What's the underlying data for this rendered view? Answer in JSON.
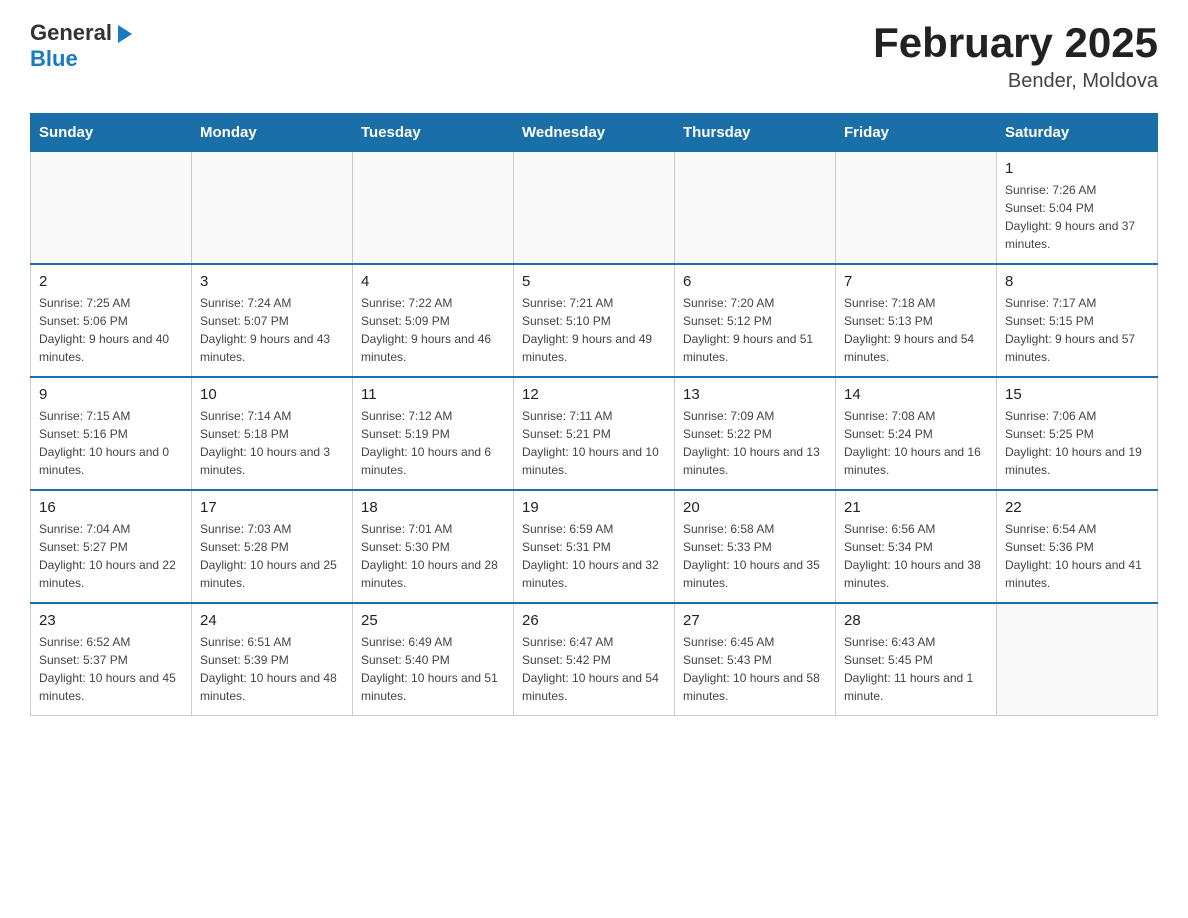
{
  "header": {
    "logo": {
      "general": "General",
      "arrow": "▶",
      "blue": "Blue"
    },
    "title": "February 2025",
    "subtitle": "Bender, Moldova"
  },
  "weekdays": [
    "Sunday",
    "Monday",
    "Tuesday",
    "Wednesday",
    "Thursday",
    "Friday",
    "Saturday"
  ],
  "weeks": [
    [
      {
        "day": "",
        "info": ""
      },
      {
        "day": "",
        "info": ""
      },
      {
        "day": "",
        "info": ""
      },
      {
        "day": "",
        "info": ""
      },
      {
        "day": "",
        "info": ""
      },
      {
        "day": "",
        "info": ""
      },
      {
        "day": "1",
        "info": "Sunrise: 7:26 AM\nSunset: 5:04 PM\nDaylight: 9 hours and 37 minutes."
      }
    ],
    [
      {
        "day": "2",
        "info": "Sunrise: 7:25 AM\nSunset: 5:06 PM\nDaylight: 9 hours and 40 minutes."
      },
      {
        "day": "3",
        "info": "Sunrise: 7:24 AM\nSunset: 5:07 PM\nDaylight: 9 hours and 43 minutes."
      },
      {
        "day": "4",
        "info": "Sunrise: 7:22 AM\nSunset: 5:09 PM\nDaylight: 9 hours and 46 minutes."
      },
      {
        "day": "5",
        "info": "Sunrise: 7:21 AM\nSunset: 5:10 PM\nDaylight: 9 hours and 49 minutes."
      },
      {
        "day": "6",
        "info": "Sunrise: 7:20 AM\nSunset: 5:12 PM\nDaylight: 9 hours and 51 minutes."
      },
      {
        "day": "7",
        "info": "Sunrise: 7:18 AM\nSunset: 5:13 PM\nDaylight: 9 hours and 54 minutes."
      },
      {
        "day": "8",
        "info": "Sunrise: 7:17 AM\nSunset: 5:15 PM\nDaylight: 9 hours and 57 minutes."
      }
    ],
    [
      {
        "day": "9",
        "info": "Sunrise: 7:15 AM\nSunset: 5:16 PM\nDaylight: 10 hours and 0 minutes."
      },
      {
        "day": "10",
        "info": "Sunrise: 7:14 AM\nSunset: 5:18 PM\nDaylight: 10 hours and 3 minutes."
      },
      {
        "day": "11",
        "info": "Sunrise: 7:12 AM\nSunset: 5:19 PM\nDaylight: 10 hours and 6 minutes."
      },
      {
        "day": "12",
        "info": "Sunrise: 7:11 AM\nSunset: 5:21 PM\nDaylight: 10 hours and 10 minutes."
      },
      {
        "day": "13",
        "info": "Sunrise: 7:09 AM\nSunset: 5:22 PM\nDaylight: 10 hours and 13 minutes."
      },
      {
        "day": "14",
        "info": "Sunrise: 7:08 AM\nSunset: 5:24 PM\nDaylight: 10 hours and 16 minutes."
      },
      {
        "day": "15",
        "info": "Sunrise: 7:06 AM\nSunset: 5:25 PM\nDaylight: 10 hours and 19 minutes."
      }
    ],
    [
      {
        "day": "16",
        "info": "Sunrise: 7:04 AM\nSunset: 5:27 PM\nDaylight: 10 hours and 22 minutes."
      },
      {
        "day": "17",
        "info": "Sunrise: 7:03 AM\nSunset: 5:28 PM\nDaylight: 10 hours and 25 minutes."
      },
      {
        "day": "18",
        "info": "Sunrise: 7:01 AM\nSunset: 5:30 PM\nDaylight: 10 hours and 28 minutes."
      },
      {
        "day": "19",
        "info": "Sunrise: 6:59 AM\nSunset: 5:31 PM\nDaylight: 10 hours and 32 minutes."
      },
      {
        "day": "20",
        "info": "Sunrise: 6:58 AM\nSunset: 5:33 PM\nDaylight: 10 hours and 35 minutes."
      },
      {
        "day": "21",
        "info": "Sunrise: 6:56 AM\nSunset: 5:34 PM\nDaylight: 10 hours and 38 minutes."
      },
      {
        "day": "22",
        "info": "Sunrise: 6:54 AM\nSunset: 5:36 PM\nDaylight: 10 hours and 41 minutes."
      }
    ],
    [
      {
        "day": "23",
        "info": "Sunrise: 6:52 AM\nSunset: 5:37 PM\nDaylight: 10 hours and 45 minutes."
      },
      {
        "day": "24",
        "info": "Sunrise: 6:51 AM\nSunset: 5:39 PM\nDaylight: 10 hours and 48 minutes."
      },
      {
        "day": "25",
        "info": "Sunrise: 6:49 AM\nSunset: 5:40 PM\nDaylight: 10 hours and 51 minutes."
      },
      {
        "day": "26",
        "info": "Sunrise: 6:47 AM\nSunset: 5:42 PM\nDaylight: 10 hours and 54 minutes."
      },
      {
        "day": "27",
        "info": "Sunrise: 6:45 AM\nSunset: 5:43 PM\nDaylight: 10 hours and 58 minutes."
      },
      {
        "day": "28",
        "info": "Sunrise: 6:43 AM\nSunset: 5:45 PM\nDaylight: 11 hours and 1 minute."
      },
      {
        "day": "",
        "info": ""
      }
    ]
  ]
}
